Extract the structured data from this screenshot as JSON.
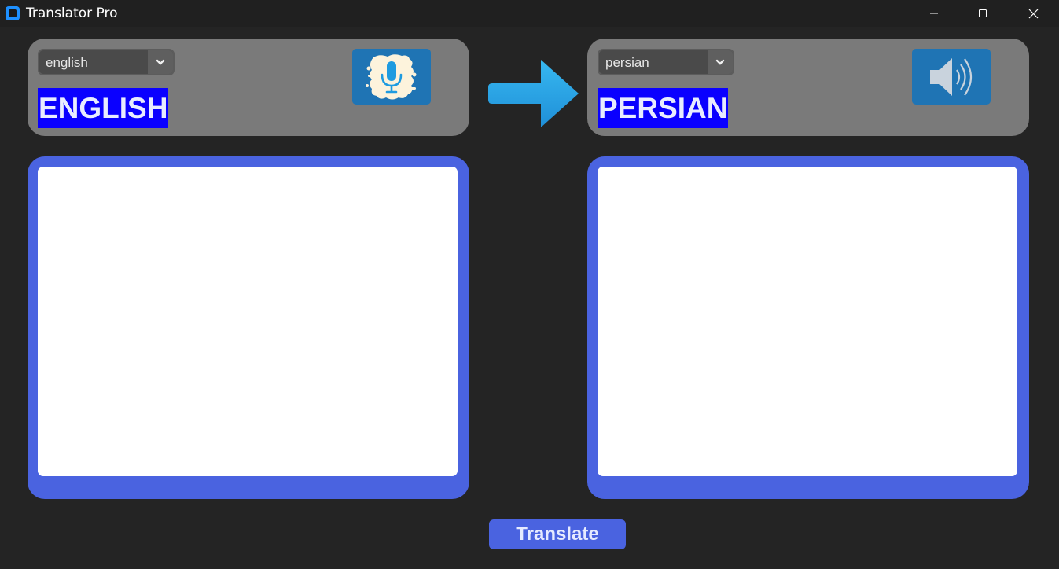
{
  "window": {
    "title": "Translator Pro",
    "controls": {
      "minimize": "minimize-icon",
      "maximize": "maximize-icon",
      "close": "close-icon"
    }
  },
  "source": {
    "selected_language": "english",
    "label": "ENGLISH",
    "action_icon": "microphone-icon",
    "text": ""
  },
  "arrow_icon": "arrow-right-icon",
  "target": {
    "selected_language": "persian",
    "label": "PERSIAN",
    "action_icon": "speaker-icon",
    "text": ""
  },
  "translate_button": {
    "label": "Translate"
  },
  "colors": {
    "background": "#242424",
    "panel": "#7a7a7a",
    "accent_blue": "#4a63e0",
    "label_highlight": "#0a00ff",
    "icon_tile": "#1f74b4",
    "arrow": "#2aa8e8"
  }
}
